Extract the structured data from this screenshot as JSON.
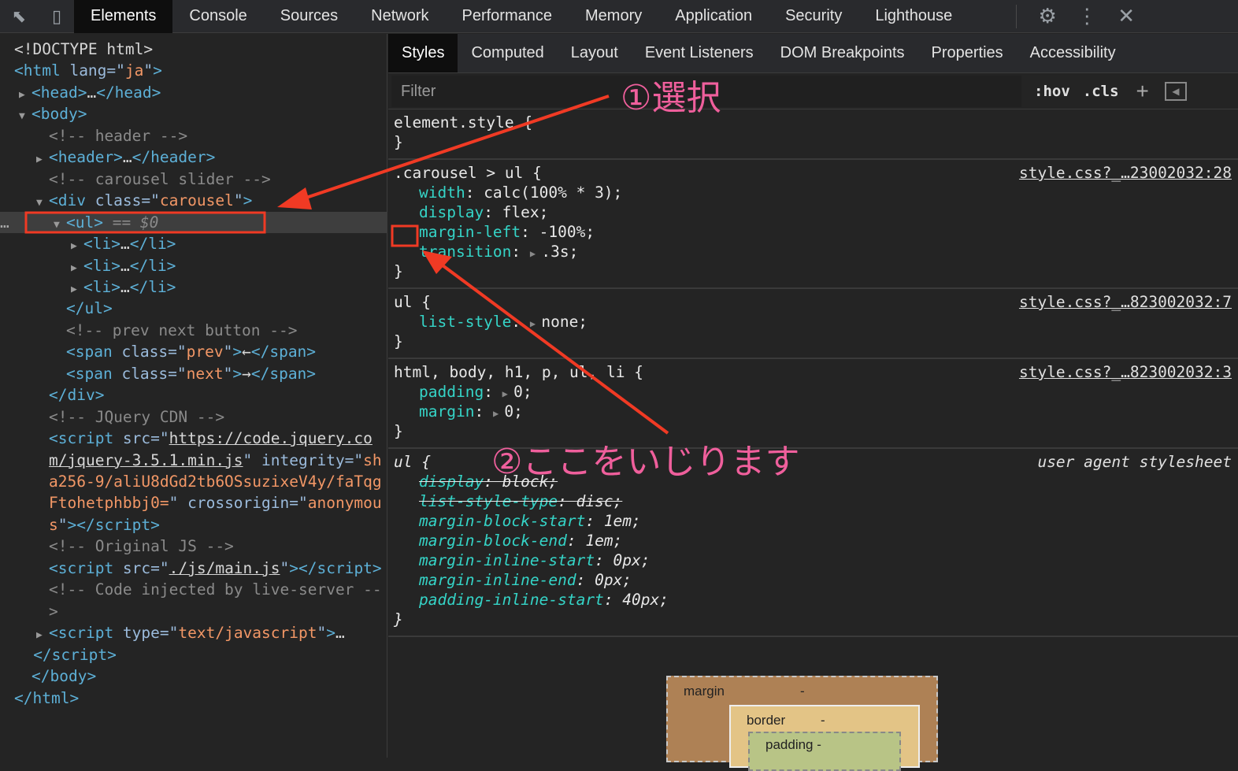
{
  "toolbar": {
    "tabs": [
      "Elements",
      "Console",
      "Sources",
      "Network",
      "Performance",
      "Memory",
      "Application",
      "Security",
      "Lighthouse"
    ],
    "selected": 0,
    "icons": [
      "inspect-element-icon",
      "device-toolbar-icon"
    ],
    "right_icons": [
      "settings-gear-icon",
      "more-options-icon",
      "close-icon"
    ]
  },
  "dom_tree": [
    {
      "indent": 0,
      "tri": "",
      "segs": [
        [
          "tx",
          "<!DOCTYPE html>"
        ]
      ]
    },
    {
      "indent": 0,
      "tri": "",
      "segs": [
        [
          "tg",
          "<html "
        ],
        [
          "at",
          "lang=\""
        ],
        [
          "vl",
          "ja"
        ],
        [
          "at",
          "\""
        ],
        [
          "tg",
          ">"
        ]
      ]
    },
    {
      "indent": 1,
      "tri": "▶",
      "segs": [
        [
          "tg",
          "<head>"
        ],
        [
          "tx",
          "…"
        ],
        [
          "tg",
          "</head>"
        ]
      ]
    },
    {
      "indent": 1,
      "tri": "▼",
      "segs": [
        [
          "tg",
          "<body>"
        ]
      ]
    },
    {
      "indent": 2,
      "tri": "",
      "segs": [
        [
          "cm",
          "<!-- header -->"
        ]
      ]
    },
    {
      "indent": 2,
      "tri": "▶",
      "segs": [
        [
          "tg",
          "<header>"
        ],
        [
          "tx",
          "…"
        ],
        [
          "tg",
          "</header>"
        ]
      ]
    },
    {
      "indent": 2,
      "tri": "",
      "segs": [
        [
          "cm",
          "<!-- carousel slider -->"
        ]
      ]
    },
    {
      "indent": 2,
      "tri": "▼",
      "segs": [
        [
          "tg",
          "<div "
        ],
        [
          "at",
          "class=\""
        ],
        [
          "vl",
          "carousel"
        ],
        [
          "at",
          "\""
        ],
        [
          "tg",
          ">"
        ]
      ]
    },
    {
      "indent": 3,
      "tri": "▼",
      "selected": true,
      "segs": [
        [
          "tg",
          "<ul>"
        ],
        [
          "dim",
          " == $0"
        ]
      ]
    },
    {
      "indent": 4,
      "tri": "▶",
      "segs": [
        [
          "tg",
          "<li>"
        ],
        [
          "tx",
          "…"
        ],
        [
          "tg",
          "</li>"
        ]
      ]
    },
    {
      "indent": 4,
      "tri": "▶",
      "segs": [
        [
          "tg",
          "<li>"
        ],
        [
          "tx",
          "…"
        ],
        [
          "tg",
          "</li>"
        ]
      ]
    },
    {
      "indent": 4,
      "tri": "▶",
      "segs": [
        [
          "tg",
          "<li>"
        ],
        [
          "tx",
          "…"
        ],
        [
          "tg",
          "</li>"
        ]
      ]
    },
    {
      "indent": 3,
      "tri": "",
      "segs": [
        [
          "tg",
          "</ul>"
        ]
      ]
    },
    {
      "indent": 3,
      "tri": "",
      "segs": [
        [
          "cm",
          "<!-- prev next button -->"
        ]
      ]
    },
    {
      "indent": 3,
      "tri": "",
      "segs": [
        [
          "tg",
          "<span "
        ],
        [
          "at",
          "class=\""
        ],
        [
          "vl",
          "prev"
        ],
        [
          "at",
          "\""
        ],
        [
          "tg",
          ">"
        ],
        [
          "tx",
          "←"
        ],
        [
          "tg",
          "</span>"
        ]
      ]
    },
    {
      "indent": 3,
      "tri": "",
      "segs": [
        [
          "tg",
          "<span "
        ],
        [
          "at",
          "class=\""
        ],
        [
          "vl",
          "next"
        ],
        [
          "at",
          "\""
        ],
        [
          "tg",
          ">"
        ],
        [
          "tx",
          "→"
        ],
        [
          "tg",
          "</span>"
        ]
      ]
    },
    {
      "indent": 2,
      "tri": "",
      "segs": [
        [
          "tg",
          "</div>"
        ]
      ]
    },
    {
      "indent": 2,
      "tri": "",
      "segs": [
        [
          "cm",
          "<!-- JQuery CDN -->"
        ]
      ]
    },
    {
      "indent": 2,
      "tri": "",
      "segs": [
        [
          "tg",
          "<script "
        ],
        [
          "at",
          "src=\""
        ],
        [
          "lk",
          "https://code.jquery.co"
        ]
      ]
    },
    {
      "indent": 2,
      "tri": "",
      "segs": [
        [
          "lk",
          "m/jquery-3.5.1.min.js"
        ],
        [
          "at",
          "\" integrity=\""
        ],
        [
          "vl",
          "sh"
        ]
      ]
    },
    {
      "indent": 2,
      "tri": "",
      "segs": [
        [
          "vl",
          "a256-9/aliU8dGd2tb6OSsuzixeV4y/faTqg"
        ]
      ]
    },
    {
      "indent": 2,
      "tri": "",
      "segs": [
        [
          "vl",
          "Ftohetphbbj0="
        ],
        [
          "at",
          "\" crossorigin=\""
        ],
        [
          "vl",
          "anonymou"
        ]
      ]
    },
    {
      "indent": 2,
      "tri": "",
      "segs": [
        [
          "vl",
          "s"
        ],
        [
          "at",
          "\""
        ],
        [
          "tg",
          "></script>"
        ]
      ]
    },
    {
      "indent": 2,
      "tri": "",
      "segs": [
        [
          "cm",
          "<!-- Original JS -->"
        ]
      ]
    },
    {
      "indent": 2,
      "tri": "",
      "segs": [
        [
          "tg",
          "<script "
        ],
        [
          "at",
          "src=\""
        ],
        [
          "lk",
          "./js/main.js"
        ],
        [
          "at",
          "\""
        ],
        [
          "tg",
          "></script>"
        ]
      ]
    },
    {
      "indent": 2,
      "tri": "",
      "segs": [
        [
          "cm",
          "<!-- Code injected by live-server --"
        ]
      ]
    },
    {
      "indent": 2,
      "tri": "",
      "segs": [
        [
          "cm",
          ">"
        ]
      ]
    },
    {
      "indent": 2,
      "tri": "▶",
      "segs": [
        [
          "tg",
          "<script "
        ],
        [
          "at",
          "type=\""
        ],
        [
          "vl",
          "text/javascript"
        ],
        [
          "at",
          "\""
        ],
        [
          "tg",
          ">"
        ],
        [
          "tx",
          "…"
        ]
      ]
    },
    {
      "indent": 1.1,
      "tri": "",
      "segs": [
        [
          "tg",
          "</script>"
        ]
      ]
    },
    {
      "indent": 1,
      "tri": "",
      "segs": [
        [
          "tg",
          "</body>"
        ]
      ]
    },
    {
      "indent": 0,
      "tri": "",
      "segs": [
        [
          "tg",
          "</html>"
        ]
      ]
    }
  ],
  "styles": {
    "subtabs": [
      "Styles",
      "Computed",
      "Layout",
      "Event Listeners",
      "DOM Breakpoints",
      "Properties",
      "Accessibility"
    ],
    "selected": 0,
    "filter_placeholder": "Filter",
    "hov": ":hov",
    "cls": ".cls",
    "add": "+",
    "rules": [
      {
        "selector": "element.style {",
        "source": "",
        "ua": false,
        "decls": []
      },
      {
        "selector": ".carousel > ul {",
        "source": "style.css?_…23002032:28",
        "ua": false,
        "decls": [
          {
            "p": "width",
            "v": "calc(100% * 3);"
          },
          {
            "p": "display",
            "v": "flex;"
          },
          {
            "p": "margin-left",
            "v": "-100%;"
          },
          {
            "p": "transition",
            "v": ".3s;",
            "arrow": true
          }
        ]
      },
      {
        "selector": "ul {",
        "source": "style.css?_…823002032:7",
        "ua": false,
        "decls": [
          {
            "p": "list-style",
            "v": "none;",
            "arrow": true
          }
        ]
      },
      {
        "selector": "html, body, h1, p, ul, li {",
        "source": "style.css?_…823002032:3",
        "ua": false,
        "decls": [
          {
            "p": "padding",
            "v": "0;",
            "arrow": true
          },
          {
            "p": "margin",
            "v": "0;",
            "arrow": true
          }
        ]
      },
      {
        "selector": "ul {",
        "source": "user agent stylesheet",
        "ua": true,
        "decls": [
          {
            "p": "display",
            "v": "block;",
            "strike": true
          },
          {
            "p": "list-style-type",
            "v": "disc;",
            "strike": true
          },
          {
            "p": "margin-block-start",
            "v": "1em;"
          },
          {
            "p": "margin-block-end",
            "v": "1em;"
          },
          {
            "p": "margin-inline-start",
            "v": "0px;"
          },
          {
            "p": "margin-inline-end",
            "v": "0px;"
          },
          {
            "p": "padding-inline-start",
            "v": "40px;"
          }
        ]
      }
    ],
    "close_brace": "}"
  },
  "box_model": {
    "margin_label": "margin",
    "margin_value": "-",
    "border_label": "border",
    "border_value": "-",
    "padding_label": "padding -"
  },
  "annotations": {
    "step1": "①選択",
    "step2": "②ここをいじります",
    "color": "#ef5f9c",
    "arrow_color": "#f03a24"
  }
}
